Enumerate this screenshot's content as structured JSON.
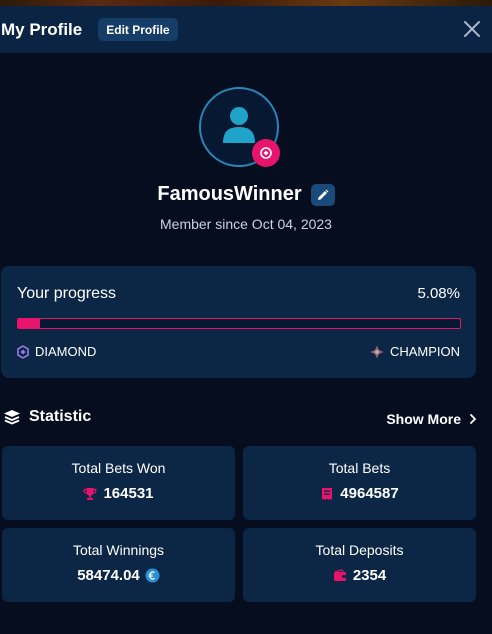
{
  "header": {
    "title": "My Profile",
    "edit_label": "Edit Profile"
  },
  "profile": {
    "username": "FamousWinner",
    "member_since": "Member since Oct 04, 2023"
  },
  "progress": {
    "title": "Your progress",
    "percent_text": "5.08%",
    "percent_value": 5.08,
    "current_rank": "DIAMOND",
    "next_rank": "CHAMPION"
  },
  "statistic": {
    "title": "Statistic",
    "show_more": "Show More",
    "cards": [
      {
        "label": "Total Bets Won",
        "value": "164531",
        "icon": "trophy-icon"
      },
      {
        "label": "Total Bets",
        "value": "4964587",
        "icon": "ticket-icon"
      },
      {
        "label": "Total Winnings",
        "value": "58474.04",
        "icon": "euro-coin-icon"
      },
      {
        "label": "Total Deposits",
        "value": "2354",
        "icon": "wallet-icon"
      }
    ]
  },
  "colors": {
    "background": "#050d1f",
    "card": "#0c2645",
    "header": "#0b2443",
    "accent": "#e8146b",
    "avatar_ring": "#2b86b8"
  }
}
